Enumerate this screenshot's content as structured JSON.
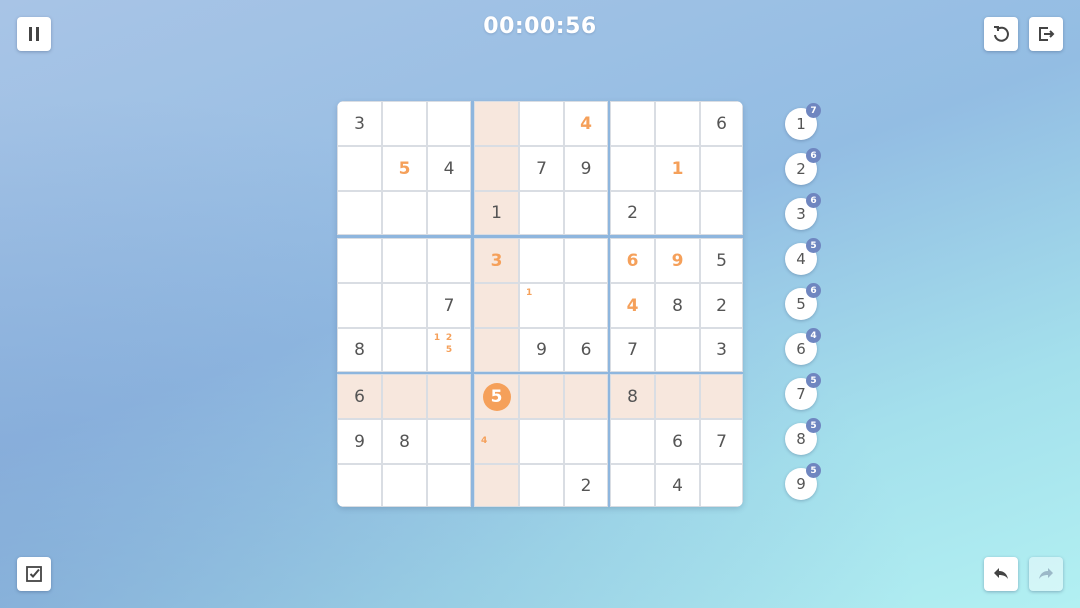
{
  "timer": "00:00:56",
  "toolbar": {
    "pause_icon": "pause-icon",
    "restart_icon": "restart-icon",
    "exit_icon": "exit-icon",
    "check_icon": "check-icon",
    "undo_icon": "undo-icon",
    "redo_icon": "redo-icon",
    "redo_enabled": false
  },
  "colors": {
    "user_digit": "#f5a05a",
    "given_digit": "#555555",
    "highlight": "#f7e7dd",
    "badge": "#6f86c0"
  },
  "board": {
    "selected": {
      "row": 6,
      "col": 3
    },
    "highlighted_row": 6,
    "highlighted_col": 3,
    "cells": [
      [
        {
          "v": "3"
        },
        {
          "v": ""
        },
        {
          "v": ""
        },
        {
          "v": ""
        },
        {
          "v": ""
        },
        {
          "v": "4",
          "user": true
        },
        {
          "v": ""
        },
        {
          "v": ""
        },
        {
          "v": "6"
        }
      ],
      [
        {
          "v": ""
        },
        {
          "v": "5",
          "user": true
        },
        {
          "v": "4"
        },
        {
          "v": ""
        },
        {
          "v": "7"
        },
        {
          "v": "9"
        },
        {
          "v": ""
        },
        {
          "v": "1",
          "user": true
        },
        {
          "v": ""
        }
      ],
      [
        {
          "v": ""
        },
        {
          "v": ""
        },
        {
          "v": ""
        },
        {
          "v": "1"
        },
        {
          "v": ""
        },
        {
          "v": ""
        },
        {
          "v": "2"
        },
        {
          "v": ""
        },
        {
          "v": ""
        }
      ],
      [
        {
          "v": ""
        },
        {
          "v": ""
        },
        {
          "v": ""
        },
        {
          "v": "3",
          "user": true
        },
        {
          "v": ""
        },
        {
          "v": ""
        },
        {
          "v": "6",
          "user": true
        },
        {
          "v": "9",
          "user": true
        },
        {
          "v": "5"
        }
      ],
      [
        {
          "v": ""
        },
        {
          "v": ""
        },
        {
          "v": "7"
        },
        {
          "v": ""
        },
        {
          "v": "",
          "notes": [
            "1",
            "",
            "",
            "",
            "",
            "",
            "",
            "",
            ""
          ]
        },
        {
          "v": ""
        },
        {
          "v": "4",
          "user": true
        },
        {
          "v": "8"
        },
        {
          "v": "2"
        }
      ],
      [
        {
          "v": "8"
        },
        {
          "v": ""
        },
        {
          "v": "",
          "notes": [
            "1",
            "2",
            "",
            "",
            "5",
            "",
            "",
            "",
            ""
          ]
        },
        {
          "v": ""
        },
        {
          "v": "9"
        },
        {
          "v": "6"
        },
        {
          "v": "7"
        },
        {
          "v": ""
        },
        {
          "v": "3"
        }
      ],
      [
        {
          "v": "6"
        },
        {
          "v": ""
        },
        {
          "v": ""
        },
        {
          "v": "5",
          "user": true
        },
        {
          "v": ""
        },
        {
          "v": ""
        },
        {
          "v": "8"
        },
        {
          "v": ""
        },
        {
          "v": ""
        }
      ],
      [
        {
          "v": "9"
        },
        {
          "v": "8"
        },
        {
          "v": ""
        },
        {
          "v": "",
          "notes": [
            "",
            "",
            "",
            "4",
            "",
            "",
            "",
            "",
            ""
          ]
        },
        {
          "v": ""
        },
        {
          "v": ""
        },
        {
          "v": ""
        },
        {
          "v": "6"
        },
        {
          "v": "7"
        }
      ],
      [
        {
          "v": ""
        },
        {
          "v": ""
        },
        {
          "v": ""
        },
        {
          "v": ""
        },
        {
          "v": ""
        },
        {
          "v": "2"
        },
        {
          "v": ""
        },
        {
          "v": "4"
        },
        {
          "v": ""
        }
      ]
    ]
  },
  "number_counters": [
    {
      "digit": "1",
      "remaining": "7"
    },
    {
      "digit": "2",
      "remaining": "6"
    },
    {
      "digit": "3",
      "remaining": "6"
    },
    {
      "digit": "4",
      "remaining": "5"
    },
    {
      "digit": "5",
      "remaining": "6"
    },
    {
      "digit": "6",
      "remaining": "4"
    },
    {
      "digit": "7",
      "remaining": "5"
    },
    {
      "digit": "8",
      "remaining": "5"
    },
    {
      "digit": "9",
      "remaining": "5"
    }
  ]
}
